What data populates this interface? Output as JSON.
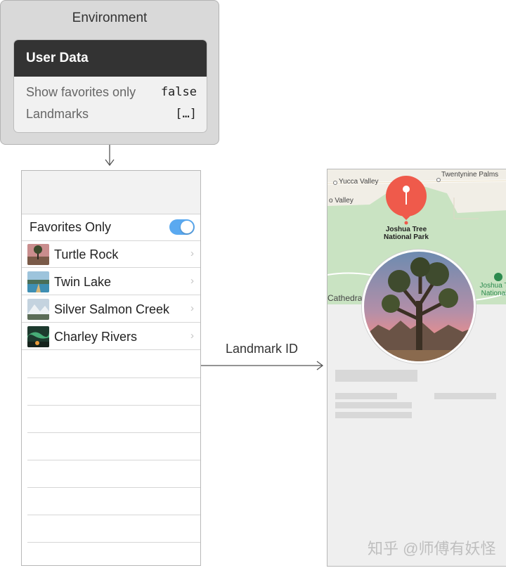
{
  "environment": {
    "title": "Environment",
    "user_data": {
      "header": "User Data",
      "rows": [
        {
          "label": "Show favorites only",
          "value": "false"
        },
        {
          "label": "Landmarks",
          "value": "[…]"
        }
      ]
    }
  },
  "connector": {
    "label": "Landmark ID"
  },
  "list_screen": {
    "favorites_toggle": {
      "label": "Favorites Only",
      "on": true
    },
    "items": [
      {
        "name": "Turtle Rock"
      },
      {
        "name": "Twin Lake"
      },
      {
        "name": "Silver Salmon Creek"
      },
      {
        "name": "Charley Rivers"
      }
    ],
    "chevron": "›"
  },
  "detail_screen": {
    "map_labels": {
      "town_1": "Yucca Valley",
      "town_2": "Twentynine Palms",
      "town_3": "o Valley",
      "town_4": "Cathedral",
      "pin_label_line1": "Joshua Tree",
      "pin_label_line2": "National Park",
      "nps_line1": "Joshua T",
      "nps_line2": "National"
    }
  },
  "watermark": "知乎 @师傅有妖怪",
  "colors": {
    "user_data_header": "#333333",
    "toggle_on": "#5aa9f0",
    "map_pin": "#ef5a4b",
    "map_park": "#c9e3c2"
  }
}
